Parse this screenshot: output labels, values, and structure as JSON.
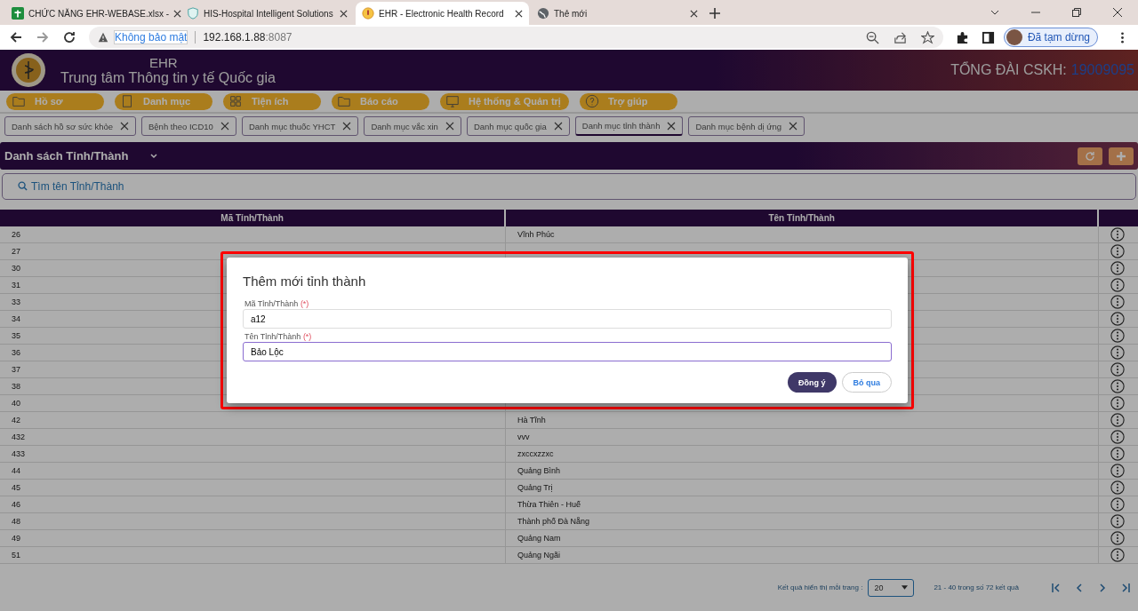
{
  "browser": {
    "tabs": [
      {
        "title": "CHỨC NĂNG EHR-WEBASE.xlsx -",
        "selected": false
      },
      {
        "title": "HIS-Hospital Intelligent Solutions",
        "selected": false
      },
      {
        "title": "EHR - Electronic Health Record",
        "selected": true
      },
      {
        "title": "Thẻ mới",
        "selected": false
      }
    ],
    "security": "Không bảo mật",
    "host": "192.168.1.88",
    "port": ":8087",
    "profile": "Đã tạm dừng"
  },
  "header": {
    "app": "EHR",
    "org": "Trung tâm Thông tin y tế Quốc gia",
    "hotline_label": "TỔNG ĐÀI CSKH:",
    "hotline": "19009095"
  },
  "menu": [
    "Hồ sơ",
    "Danh mục",
    "Tiện ích",
    "Báo cáo",
    "Hệ thống & Quản trị",
    "Trợ giúp"
  ],
  "open_tabs": [
    {
      "label": "Danh sách hồ sơ sức khỏe",
      "selected": false
    },
    {
      "label": "Bệnh theo ICD10",
      "selected": false
    },
    {
      "label": "Danh mục thuốc YHCT",
      "selected": false
    },
    {
      "label": "Danh mục vắc xin",
      "selected": false
    },
    {
      "label": "Danh mục quốc gia",
      "selected": false
    },
    {
      "label": "Danh mục tỉnh thành",
      "selected": true
    },
    {
      "label": "Danh mục bệnh dị ứng",
      "selected": false
    }
  ],
  "page": {
    "title": "Danh sách Tỉnh/Thành",
    "search_placeholder": "Tìm tên Tỉnh/Thành",
    "columns": [
      "Mã Tỉnh/Thành",
      "Tên Tỉnh/Thành"
    ],
    "rows": [
      {
        "code": "26",
        "name": "Vĩnh Phúc"
      },
      {
        "code": "27"
      },
      {
        "code": "30"
      },
      {
        "code": "31"
      },
      {
        "code": "33"
      },
      {
        "code": "34"
      },
      {
        "code": "35"
      },
      {
        "code": "36"
      },
      {
        "code": "37"
      },
      {
        "code": "38"
      },
      {
        "code": "40"
      },
      {
        "code": "42",
        "name": "Hà Tĩnh"
      },
      {
        "code": "432",
        "name": "vvv"
      },
      {
        "code": "433",
        "name": "zxccxzzxc"
      },
      {
        "code": "44",
        "name": "Quảng Bình"
      },
      {
        "code": "45",
        "name": "Quảng Trị"
      },
      {
        "code": "46",
        "name": "Thừa Thiên - Huế"
      },
      {
        "code": "48",
        "name": "Thành phố Đà Nẵng"
      },
      {
        "code": "49",
        "name": "Quảng Nam"
      },
      {
        "code": "51",
        "name": "Quảng Ngãi"
      }
    ],
    "pagination": {
      "label": "Kết quả hiển thị mỗi trang :",
      "page_size": "20",
      "range": "21 - 40 trong số 72 kết quả"
    }
  },
  "dialog": {
    "title": "Thêm mới tỉnh thành",
    "fields": [
      {
        "label": "Mã Tỉnh/Thành",
        "required": "(*)",
        "value": "a12",
        "focused": false
      },
      {
        "label": "Tên Tỉnh/Thành",
        "required": "(*)",
        "value": "Bảo Lộc",
        "focused": true
      }
    ],
    "buttons": [
      {
        "label": "Đồng ý",
        "kind": "primary"
      },
      {
        "label": "Bỏ qua",
        "kind": "secondary"
      }
    ]
  }
}
